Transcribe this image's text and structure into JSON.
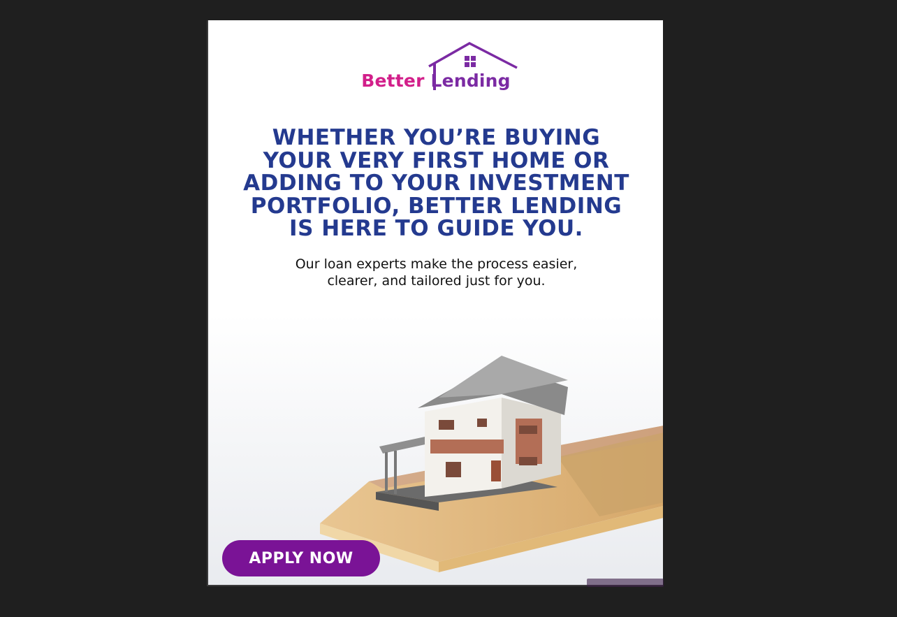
{
  "ad": {
    "logo": {
      "word1": "Better",
      "word2": "Lending",
      "colors": {
        "better": "#d21f8a",
        "lending": "#7b2aa3"
      }
    },
    "headline_lines": [
      "Whether you’re buying",
      "your very first home or",
      "adding to your investment",
      "portfolio, Better Lending",
      "is here to guide you."
    ],
    "subtext_lines": [
      "Our loan experts make the process easier,",
      "clearer, and tailored just for you."
    ],
    "cta_label": "APPLY NOW",
    "image_alt": "house-model-on-money-stack",
    "colors": {
      "headline": "#243a8f",
      "cta": "#7a1396",
      "backdrop": "#1f1f1f"
    }
  }
}
